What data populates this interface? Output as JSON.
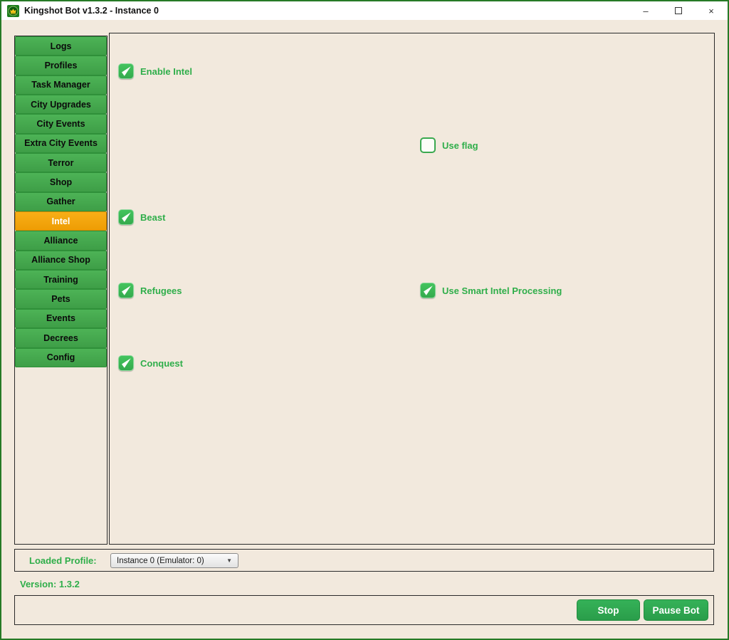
{
  "window": {
    "title": "Kingshot Bot v1.3.2 - Instance 0",
    "controls": {
      "minimize_glyph": "–",
      "close_glyph": "×"
    }
  },
  "sidebar": {
    "items": [
      {
        "label": "Logs",
        "active": false
      },
      {
        "label": "Profiles",
        "active": false
      },
      {
        "label": "Task Manager",
        "active": false
      },
      {
        "label": "City Upgrades",
        "active": false
      },
      {
        "label": "City Events",
        "active": false
      },
      {
        "label": "Extra City Events",
        "active": false
      },
      {
        "label": "Terror",
        "active": false
      },
      {
        "label": "Shop",
        "active": false
      },
      {
        "label": "Gather",
        "active": false
      },
      {
        "label": "Intel",
        "active": true
      },
      {
        "label": "Alliance",
        "active": false
      },
      {
        "label": "Alliance Shop",
        "active": false
      },
      {
        "label": "Training",
        "active": false
      },
      {
        "label": "Pets",
        "active": false
      },
      {
        "label": "Events",
        "active": false
      },
      {
        "label": "Decrees",
        "active": false
      },
      {
        "label": "Config",
        "active": false
      }
    ]
  },
  "main": {
    "checkboxes": [
      {
        "label": "Enable Intel",
        "checked": true
      },
      {
        "label": "Use flag",
        "checked": false
      },
      {
        "label": "Beast",
        "checked": true
      },
      {
        "label": "Refugees",
        "checked": true
      },
      {
        "label": "Use Smart Intel Processing",
        "checked": true
      },
      {
        "label": "Conquest",
        "checked": true
      }
    ]
  },
  "footer": {
    "loaded_profile_label": "Loaded Profile:",
    "profile_dropdown_value": "Instance 0 (Emulator: 0)",
    "version_label": "Version: 1.3.2",
    "stop_button": "Stop",
    "pause_button": "Pause Bot"
  },
  "colors": {
    "window_border": "#267a26",
    "background": "#f2e9dd",
    "sidebar_button_green": "#43a74b",
    "active_tab_orange": "#f2a40c",
    "checkbox_green": "#3cbc56",
    "label_green": "#2fae4a",
    "action_button_green": "#2fa850"
  }
}
